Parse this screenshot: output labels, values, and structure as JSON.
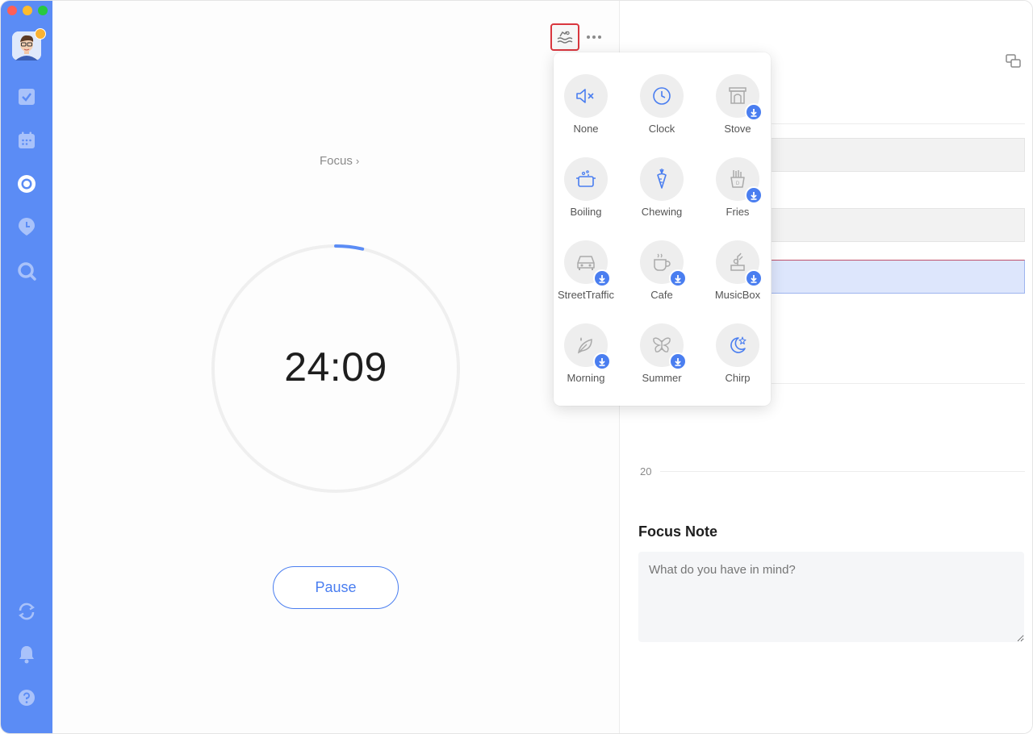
{
  "sidebar": {
    "icons": [
      "avatar",
      "checkbox-icon",
      "calendar-icon",
      "focus-icon",
      "stats-icon",
      "search-icon",
      "sync-icon",
      "bell-icon",
      "help-icon"
    ],
    "accent": "#5b8cf5"
  },
  "timer": {
    "focus_label": "Focus",
    "focus_chevron": "›",
    "time": "24:09",
    "progress": 0.035,
    "pause_label": "Pause",
    "accent": "#4a7ef0"
  },
  "sound_menu": {
    "items": [
      {
        "label": "None",
        "icon": "mute-icon",
        "download": false
      },
      {
        "label": "Clock",
        "icon": "clock-icon",
        "download": false
      },
      {
        "label": "Stove",
        "icon": "stove-icon",
        "download": true
      },
      {
        "label": "Boiling",
        "icon": "pot-icon",
        "download": false
      },
      {
        "label": "Chewing",
        "icon": "carrot-icon",
        "download": false
      },
      {
        "label": "Fries",
        "icon": "fries-icon",
        "download": true
      },
      {
        "label": "StreetTraffic",
        "icon": "car-icon",
        "download": true
      },
      {
        "label": "Cafe",
        "icon": "coffee-icon",
        "download": true
      },
      {
        "label": "MusicBox",
        "icon": "musicbox-icon",
        "download": true
      },
      {
        "label": "Morning",
        "icon": "leaf-icon",
        "download": true
      },
      {
        "label": "Summer",
        "icon": "butterfly-icon",
        "download": true
      },
      {
        "label": "Chirp",
        "icon": "moon-icon",
        "download": false
      }
    ]
  },
  "right": {
    "tick_label": "20",
    "note_title": "Focus Note",
    "note_placeholder": "What do you have in mind?"
  }
}
